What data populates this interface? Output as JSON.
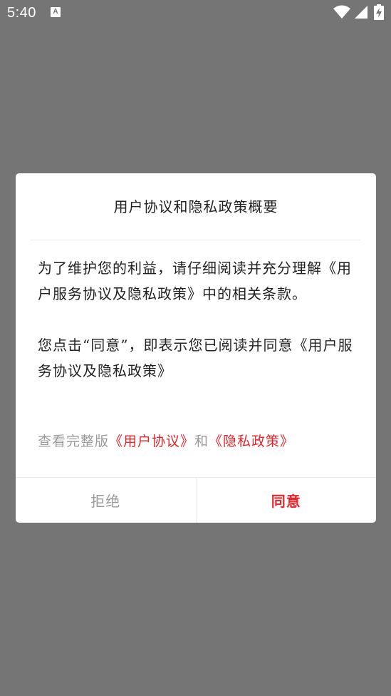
{
  "status_bar": {
    "time": "5:40",
    "notification_glyph": "A",
    "icons": [
      "notification-a-icon",
      "wifi-icon",
      "signal-icon",
      "battery-charging-icon"
    ]
  },
  "dialog": {
    "title": "用户协议和隐私政策概要",
    "paragraph_1": "为了维护您的利益，请仔细阅读并充分理解《用户服务协议及隐私政策》中的相关条款。",
    "paragraph_2": "您点击“同意”，即表示您已阅读并同意《用户服务协议及隐私政策》",
    "links_prefix": "查看完整版",
    "user_agreement_link": "《用户协议》",
    "links_joiner": "和",
    "privacy_policy_link": "《隐私政策》",
    "refuse_button": "拒绝",
    "agree_button": "同意"
  },
  "colors": {
    "scrim": "#757575",
    "accent_red": "#e4252a",
    "muted_text": "#9a9a9a",
    "body_text": "#222222"
  }
}
